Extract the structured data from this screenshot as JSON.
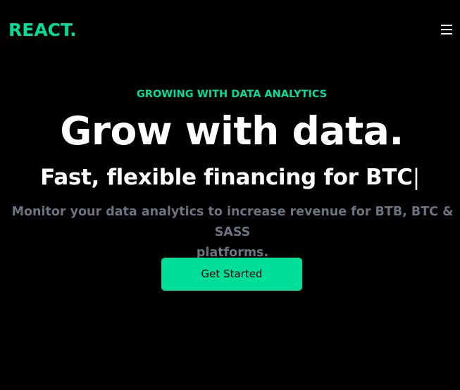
{
  "colors": {
    "background": "#000000",
    "accent": "#00df9a",
    "headline": "#ffffff",
    "muted": "#6b7280"
  },
  "navbar": {
    "logo": "REACT.",
    "menu_icon": "hamburger-menu-icon"
  },
  "hero": {
    "eyebrow": "GROWING WITH DATA ANALYTICS",
    "headline": "Grow with data.",
    "subline": "Fast, flexible financing for BTC",
    "caret": "|",
    "description_line1": "Monitor your data analytics to increase revenue for BTB, BTC & SASS",
    "description_line2": "platforms.",
    "cta_label": "Get Started"
  }
}
